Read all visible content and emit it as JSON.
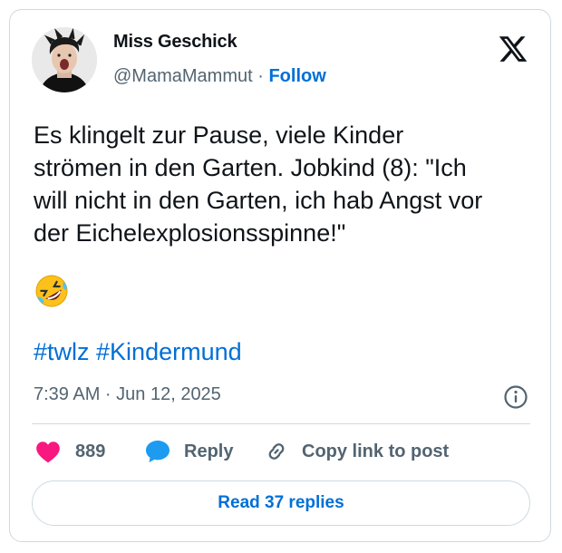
{
  "author": {
    "name": "Miss Geschick",
    "handle": "@MamaMammut",
    "separator": "·",
    "follow_label": "Follow"
  },
  "tweet": {
    "text": "Es klingelt zur Pause, viele Kinder\nströmen in den Garten. Jobkind (8): \"Ich\nwill nicht in den Garten, ich hab Angst vor\nder Eichelexplosionsspinne!\"",
    "emoji": "rolling-on-the-floor-laughing-emoji",
    "hashtags": [
      "#twlz",
      "#Kindermund"
    ],
    "timestamp": "7:39 AM · Jun 12, 2025"
  },
  "actions": {
    "likes_count": "889",
    "reply_label": "Reply",
    "copy_link_label": "Copy link to post"
  },
  "read_replies_label": "Read 37 replies",
  "colors": {
    "accent": "#006fd6",
    "like": "#f91880",
    "reply": "#1d9bf0",
    "muted": "#536471",
    "border": "#cfd9de"
  },
  "icons": [
    "x-logo-icon",
    "info-icon",
    "heart-icon",
    "reply-bubble-icon",
    "link-icon"
  ]
}
